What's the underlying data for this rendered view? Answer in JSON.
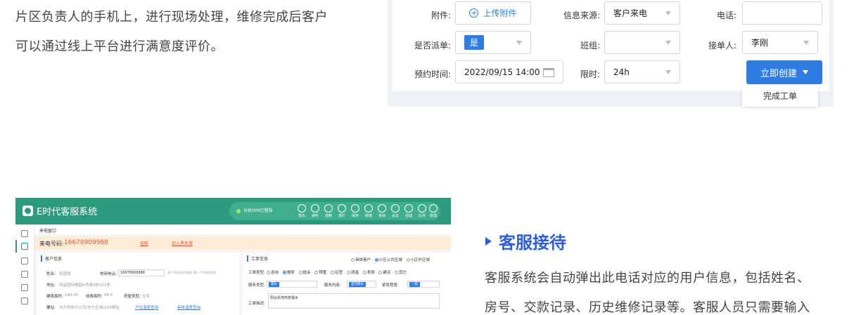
{
  "intro": {
    "lines": [
      "片区负责人的手机上，进行现场处理，维修完成后客户",
      "可以通过线上平台进行满意度评价。"
    ]
  },
  "order_form": {
    "attachment_label": "附件:",
    "upload_label": "上传附件",
    "source_label": "信息来源:",
    "source_value": "客户来电",
    "phone_label": "电话:",
    "phone_value": "",
    "dispatch_label": "是否派单:",
    "dispatch_value": "是",
    "team_label": "班组:",
    "team_value": "",
    "receiver_label": "接单人:",
    "receiver_value": "李刚",
    "appointment_label": "预约时间:",
    "appointment_value": "2022/09/15 14:00",
    "limit_label": "限时:",
    "limit_value": "24h",
    "create_button": "立即创建",
    "dropdown_option": "完成工单"
  },
  "app": {
    "title": "E时代客服系统",
    "status_text": "分机009已登陆",
    "toolbar": [
      "签出",
      "接听",
      "挂断",
      "拨打",
      "保持",
      "转接",
      "咨询",
      "会议",
      "强插",
      "队列",
      "管理"
    ],
    "tab_label": "来电窗口",
    "call_label": "来电号码:",
    "call_number": "16678909988",
    "blacklist_link": "挂断",
    "add_blacklist_link": "加入黑名单",
    "customer": {
      "title": "客户信息",
      "name_label": "姓名:",
      "name_value": "张国强",
      "phone_label": "常用电话:",
      "phone_value": "16678909988",
      "phone_hint": "多个号码用逗号隔开,第一个为常用号码",
      "address_label": "地址:",
      "address_value": "同益国际雅园A号楼3栋101室",
      "area_label": "建筑面积:",
      "area_value": "146.45",
      "fee_area_label": "收费面积:",
      "fee_area_value": "98.6",
      "house_type_label": "房屋类型:",
      "house_type_value": "住宅",
      "region_label": "要站:",
      "region_value": "东方供热分公司/东方区域/200期站",
      "link1": "户位温度查询",
      "link2": "具体温度查询"
    },
    "ticket": {
      "title": "工单信息",
      "scope_options": [
        "具体客户",
        "小区公共区域",
        "小区外区域"
      ],
      "type_label": "工单类型:",
      "type_options": [
        "咨询",
        "报修",
        "投诉",
        "预置",
        "经营",
        "测温",
        "表扬",
        "建议",
        "其它"
      ],
      "service_type_label": "服务类型:",
      "service_type_value": "漏水",
      "service_content_label": "服务内容:",
      "service_content_value": "室内漏水",
      "urgency_label": "紧急程度:",
      "urgency_value": "一般",
      "desc_label": "工单描述:",
      "desc_value": "阳台处地热管漏水"
    }
  },
  "feature": {
    "title": "客服接待",
    "lines": [
      "客服系统会自动弹出此电话对应的用户信息，包括姓名、",
      "房号、交款记录、历史维修记录等。客服人员只需要输入"
    ]
  },
  "colors": {
    "accent": "#2f7de1",
    "brand_green": "#2b9a7e",
    "title_blue": "#2f5fd0",
    "call_orange": "#e2582a"
  }
}
